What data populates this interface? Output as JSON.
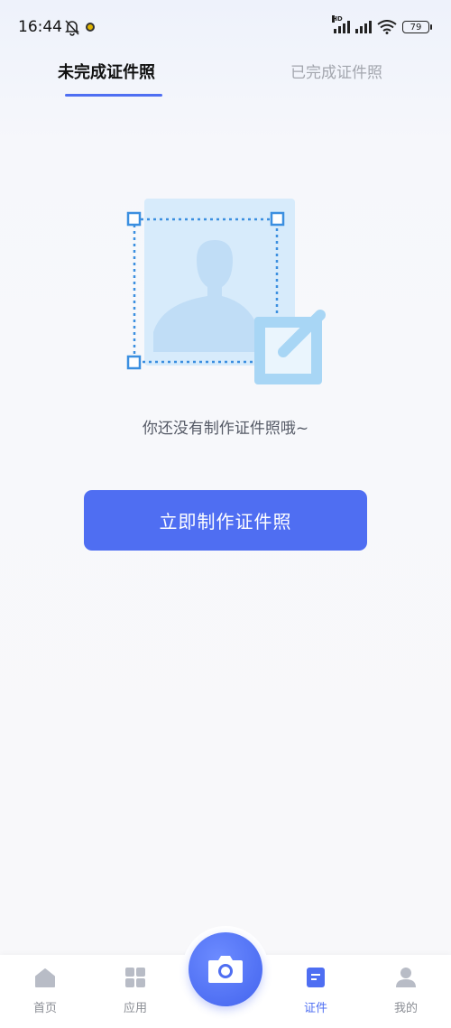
{
  "status": {
    "time": "16:44",
    "battery": "79"
  },
  "tabs": [
    {
      "label": "未完成证件照",
      "active": true
    },
    {
      "label": "已完成证件照",
      "active": false
    }
  ],
  "empty_state": {
    "message": "你还没有制作证件照哦~"
  },
  "primary_button": {
    "label": "立即制作证件照"
  },
  "bottom_nav": [
    {
      "label": "首页",
      "icon": "home-icon"
    },
    {
      "label": "应用",
      "icon": "grid-icon"
    },
    {
      "label": "",
      "icon": "camera-icon"
    },
    {
      "label": "证件",
      "icon": "document-icon",
      "active": true
    },
    {
      "label": "我的",
      "icon": "user-icon"
    }
  ],
  "colors": {
    "accent": "#4e6ef2",
    "inactive": "#a3a6ae"
  }
}
